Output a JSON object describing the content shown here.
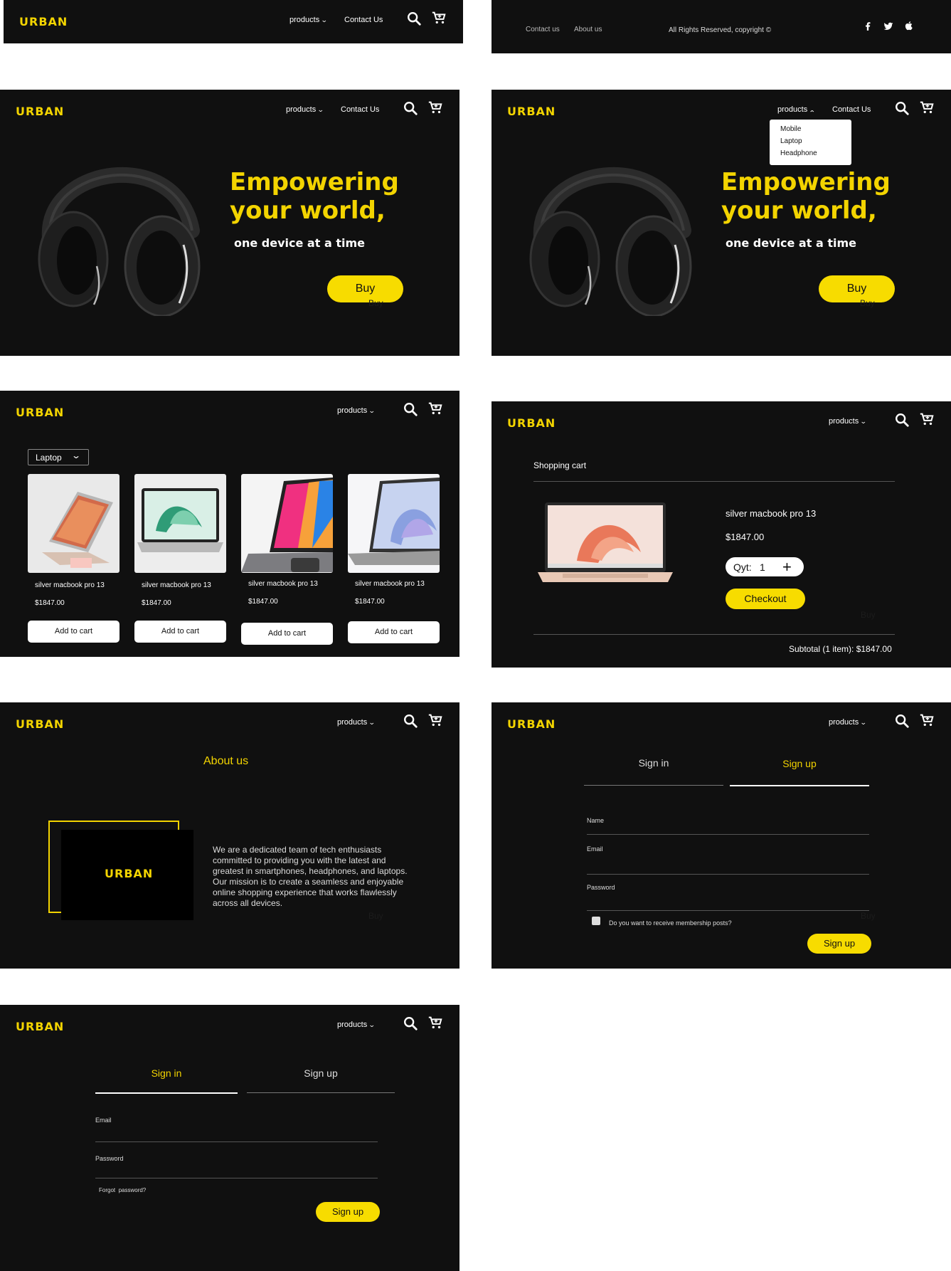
{
  "brand": {
    "logo": "URBAN",
    "accent": "#f3d400",
    "background": "#101010"
  },
  "nav": {
    "products": "products",
    "contact": "Contact Us",
    "search_icon": "search-icon",
    "cart_icon": "cart-icon"
  },
  "footer": {
    "contact": "Contact us",
    "about": "About us",
    "copyright": "All Rights Reserved, copyright ©",
    "social": [
      "facebook-icon",
      "twitter-icon",
      "apple-icon"
    ]
  },
  "hero": {
    "title_line1": "Empowering",
    "title_line2": "your world,",
    "subtitle": "one device at a time",
    "buy_label": "Buy",
    "ghost": "Buy"
  },
  "dropdown": {
    "items": [
      "Mobile",
      "Laptop",
      "Headphone"
    ]
  },
  "catalog": {
    "filter_label": "Laptop",
    "products": [
      {
        "name": "silver macbook pro 13",
        "price": "$1847.00",
        "button": "Add to cart"
      },
      {
        "name": "silver macbook pro 13",
        "price": "$1847.00",
        "button": "Add to cart"
      },
      {
        "name": "silver macbook pro 13",
        "price": "$1847.00",
        "button": "Add to cart"
      },
      {
        "name": "silver macbook pro 13",
        "price": "$1847.00",
        "button": "Add to cart"
      }
    ]
  },
  "cart": {
    "title": "Shopping cart",
    "item_name": "silver macbook pro 13",
    "item_price": "$1847.00",
    "qty_label": "Qyt:",
    "qty_value": "1",
    "checkout": "Checkout",
    "subtotal": "Subtotal (1 item): $1847.00"
  },
  "about": {
    "title": "About us",
    "logo": "URBAN",
    "text": "We are a dedicated team of tech enthusiasts committed to providing you with the latest and greatest in smartphones, headphones, and laptops. Our mission is to create a seamless and enjoyable online shopping experience that works flawlessly across all devices."
  },
  "signup": {
    "tab_signin": "Sign in",
    "tab_signup": "Sign up",
    "name_label": "Name",
    "email_label": "Email",
    "password_label": "Password",
    "checkbox_label": "Do you want to receive membership posts?",
    "submit": "Sign up"
  },
  "signin": {
    "tab_signin": "Sign in",
    "tab_signup": "Sign up",
    "email_label": "Email",
    "password_label": "Password",
    "forgot": "Forgot  password?",
    "submit": "Sign up"
  }
}
